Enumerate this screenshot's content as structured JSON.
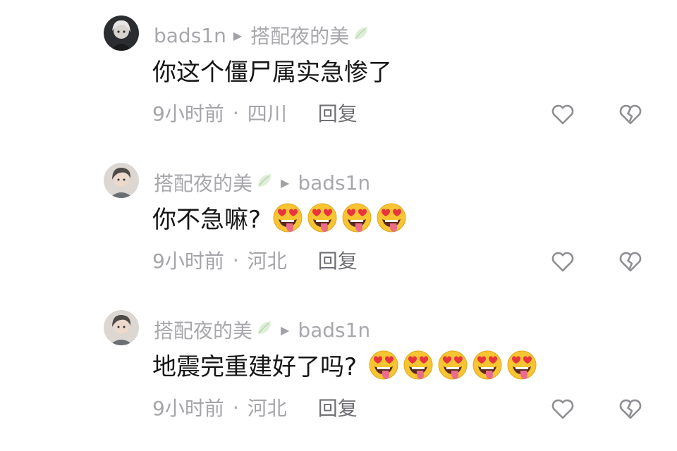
{
  "colors": {
    "text_primary": "#161616",
    "text_secondary": "#a7a7ac",
    "reply": "#6f6f74",
    "icon": "#8e8e93"
  },
  "comments": [
    {
      "author": "bads1n",
      "author_badge": "",
      "reply_to": "搭配夜的美",
      "reply_to_badge": "leaf-icon",
      "text": "你这个僵尸属实急惨了",
      "emoji_count": 0,
      "time": "9小时前",
      "location": "四川",
      "reply_label": "回复"
    },
    {
      "author": "搭配夜的美",
      "author_badge": "leaf-icon",
      "reply_to": "bads1n",
      "reply_to_badge": "",
      "text": "你不急嘛?",
      "emoji_count": 4,
      "time": "9小时前",
      "location": "河北",
      "reply_label": "回复"
    },
    {
      "author": "搭配夜的美",
      "author_badge": "leaf-icon",
      "reply_to": "bads1n",
      "reply_to_badge": "",
      "text": "地震完重建好了吗?",
      "emoji_count": 5,
      "time": "9小时前",
      "location": "河北",
      "reply_label": "回复"
    }
  ],
  "separators": {
    "dot": "·"
  },
  "icons": {
    "like": "heart-outline-icon",
    "dislike": "broken-heart-icon",
    "emoji": "heart-eyes-tongue-emoji",
    "arrow": "play-triangle-icon"
  }
}
